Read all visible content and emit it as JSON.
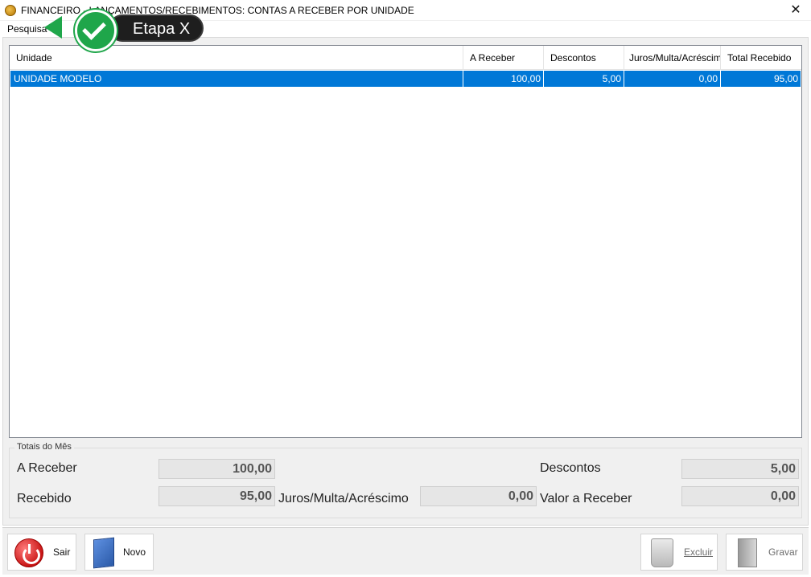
{
  "window": {
    "title": "FINANCEIRO - LANÇAMENTOS/RECEBIMENTOS: CONTAS A RECEBER POR UNIDADE",
    "close_glyph": "✕"
  },
  "menu": {
    "items": [
      "Pesquisa"
    ]
  },
  "grid": {
    "columns": [
      "Unidade",
      "A Receber",
      "Descontos",
      "Juros/Multa/Acréscimo",
      "Total Recebido"
    ],
    "rows": [
      {
        "unidade": "UNIDADE MODELO",
        "a_receber": "100,00",
        "descontos": "5,00",
        "juros": "0,00",
        "total_recebido": "95,00",
        "selected": true
      }
    ]
  },
  "totais": {
    "legend": "Totais do Mês",
    "a_receber_label": "A Receber",
    "a_receber_value": "100,00",
    "descontos_label": "Descontos",
    "descontos_value": "5,00",
    "recebido_label": "Recebido",
    "recebido_value": "95,00",
    "juros_label": "Juros/Multa/Acréscimo",
    "juros_value": "0,00",
    "valor_a_receber_label": "Valor a Receber",
    "valor_a_receber_value": "0,00"
  },
  "buttons": {
    "sair": "Sair",
    "novo": "Novo",
    "excluir": "Excluir",
    "gravar": "Gravar"
  },
  "badge": {
    "text": "Etapa X"
  },
  "icons": {
    "app": "app-icon",
    "close": "close-icon",
    "sair": "power-icon",
    "novo": "new-document-icon",
    "excluir": "trash-icon",
    "gravar": "save-icon",
    "badge": "checkmark-icon"
  },
  "colors": {
    "selection": "#0078d7",
    "panel": "#f0f0f0",
    "badge_green": "#1fa64a",
    "badge_dark": "#1e1e1e"
  }
}
